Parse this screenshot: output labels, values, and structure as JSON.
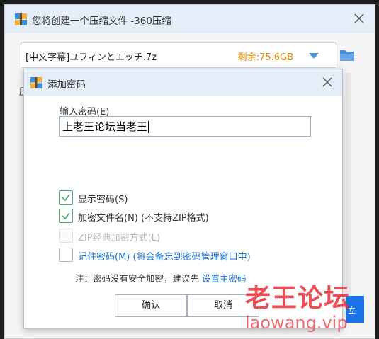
{
  "main_window": {
    "title": "您将创建一个压缩文件 -360压缩",
    "archive_path": "[中文字幕]ユフィンとエッチ.7z",
    "free_space": "剩余:75.6GB",
    "side_label": "压",
    "side_button_label": "立"
  },
  "dialog": {
    "title": "添加密码",
    "password_label": "输入密码(E)",
    "password_value": "上老王论坛当老王",
    "options": [
      {
        "label": "显示密码(S)",
        "checked": true,
        "enabled": true
      },
      {
        "label": "加密文件名(N) (不支持ZIP格式)",
        "checked": true,
        "enabled": true
      },
      {
        "label": "ZIP经典加密方式(L)",
        "checked": false,
        "enabled": false
      },
      {
        "label": "记住密码(M) (将会备忘到密码管理窗口中)",
        "checked": false,
        "enabled": true
      }
    ],
    "note_prefix": "注：密码没有安全加密，建议先",
    "note_link": "设置主密码",
    "ok_label": "确认",
    "cancel_label": "取消"
  },
  "watermark": {
    "title": "老王论坛",
    "url": "laowang.vip"
  },
  "colors": {
    "titlebar": "#e5eef8",
    "accent_blue": "#4a8fd9",
    "free_space": "#e68a00",
    "check_green": "#4caf74",
    "link": "#1a73c8",
    "watermark": "#e8303a"
  }
}
